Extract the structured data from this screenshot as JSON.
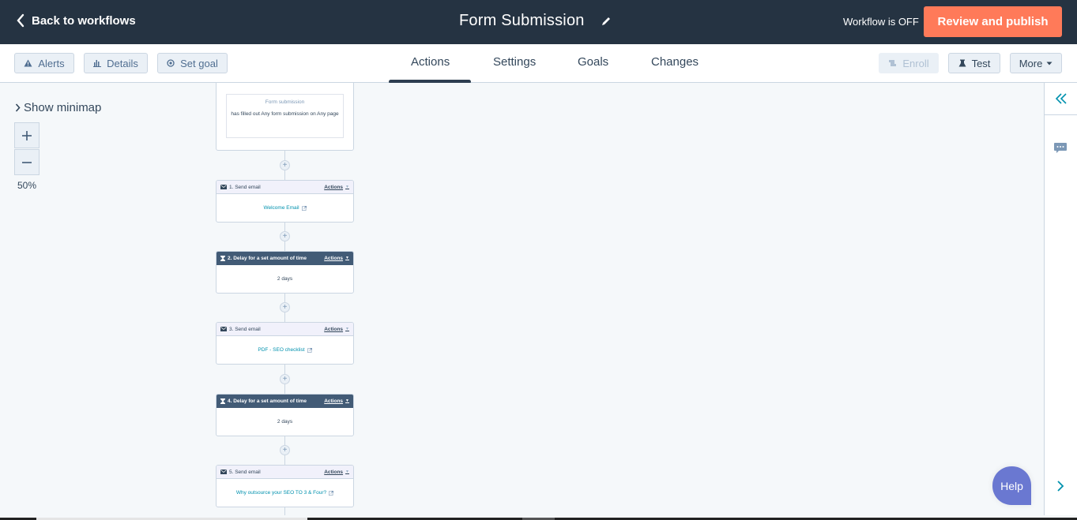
{
  "header": {
    "back_label": "Back to workflows",
    "title": "Form Submission",
    "workflow_status": "Workflow is OFF",
    "publish_label": "Review and publish"
  },
  "toolbar": {
    "left_buttons": [
      {
        "label": "Alerts",
        "icon": "warning-icon"
      },
      {
        "label": "Details",
        "icon": "bar-chart-icon"
      },
      {
        "label": "Set goal",
        "icon": "target-icon"
      }
    ],
    "tabs": [
      {
        "label": "Actions",
        "active": true
      },
      {
        "label": "Settings",
        "active": false
      },
      {
        "label": "Goals",
        "active": false
      },
      {
        "label": "Changes",
        "active": false
      }
    ],
    "right_buttons": [
      {
        "label": "Enroll",
        "icon": "enroll-icon",
        "disabled": true
      },
      {
        "label": "Test",
        "icon": "flask-icon",
        "disabled": false
      },
      {
        "label": "More",
        "icon": "caret-down-icon",
        "disabled": false
      }
    ]
  },
  "canvas": {
    "minimap_label": "Show minimap",
    "zoom_in": "+",
    "zoom_out": "−",
    "zoom_level": "50%",
    "trigger": {
      "title": "Form submission",
      "text": "has filled out Any form submission on Any page"
    },
    "actions_label": "Actions",
    "steps": [
      {
        "type": "email",
        "header": "1. Send email",
        "body": "Welcome Email",
        "link": true
      },
      {
        "type": "delay",
        "header": "2. Delay for a set amount of time",
        "body": "2 days",
        "link": false
      },
      {
        "type": "email",
        "header": "3. Send email",
        "body": "PDF - SEO checklist",
        "link": true
      },
      {
        "type": "delay",
        "header": "4. Delay for a set amount of time",
        "body": "2 days",
        "link": false
      },
      {
        "type": "email",
        "header": "5. Send email",
        "body": "Why outsource your SEO TO 3 & Four?",
        "link": true
      }
    ]
  },
  "help_label": "Help",
  "colors": {
    "header_bg": "#253342",
    "accent_orange": "#ff7a59",
    "link_teal": "#0091ae",
    "delay_header": "#425b76",
    "help_purple": "#6a78d1"
  }
}
